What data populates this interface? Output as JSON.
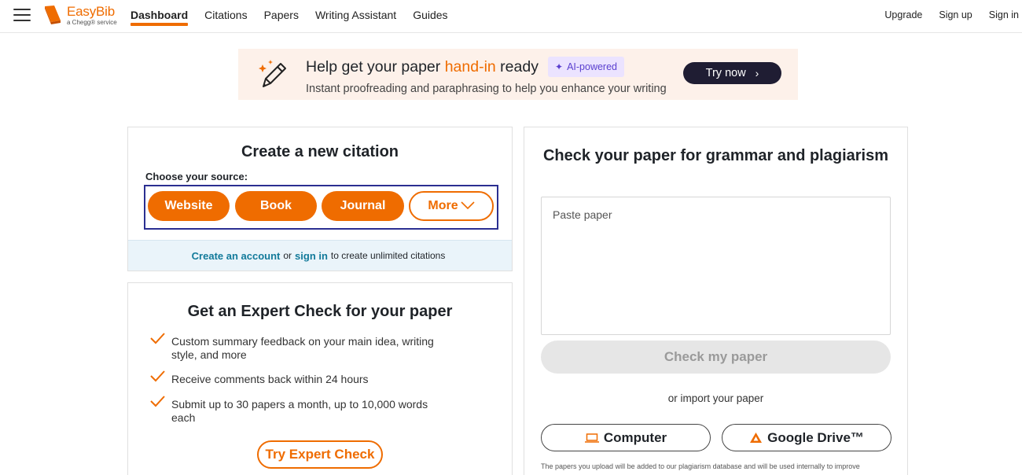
{
  "nav": {
    "logo_name": "EasyBib",
    "logo_tag": "a Chegg® service",
    "links": [
      "Dashboard",
      "Citations",
      "Papers",
      "Writing Assistant",
      "Guides"
    ],
    "right": [
      "Upgrade",
      "Sign up",
      "Sign in"
    ]
  },
  "banner": {
    "title_pre": "Help get your paper ",
    "title_highlight": "hand-in",
    "title_post": " ready",
    "badge": "AI-powered",
    "subtitle": "Instant proofreading and paraphrasing to help you enhance your writing",
    "cta": "Try now"
  },
  "citation": {
    "title": "Create a new citation",
    "choose_label": "Choose your source:",
    "sources": [
      "Website",
      "Book",
      "Journal"
    ],
    "more": "More",
    "footer_link1": "Create an account",
    "footer_or": "or",
    "footer_link2": "sign in",
    "footer_rest": "to create unlimited citations"
  },
  "expert": {
    "title": "Get an Expert Check for your paper",
    "items": [
      "Custom summary feedback on your main idea, writing style, and more",
      "Receive comments back within 24 hours",
      "Submit up to 30 papers a month, up to 10,000 words each"
    ],
    "cta": "Try Expert Check"
  },
  "grammar": {
    "title": "Check your paper for grammar and plagiarism",
    "placeholder": "Paste paper",
    "check_btn": "Check my paper",
    "import_text": "or import your paper",
    "computer_btn": "Computer",
    "drive_btn": "Google Drive™",
    "disclaimer": "The papers you upload will be added to our plagiarism database and will be used internally to improve"
  },
  "colors": {
    "accent": "#ef6c00",
    "dark": "#1f1d33",
    "link": "#127a9a",
    "focus_border": "#2b2f91"
  }
}
